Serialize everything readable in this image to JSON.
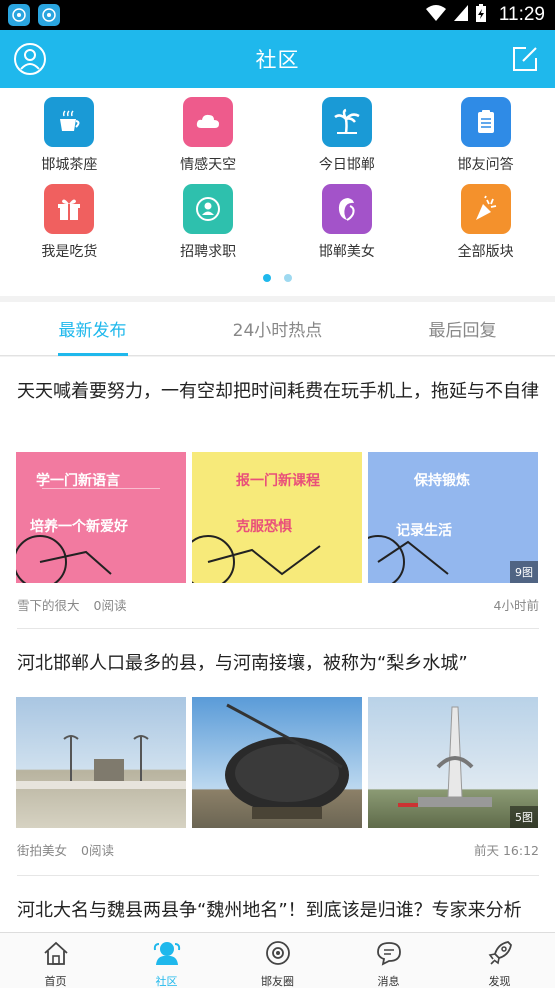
{
  "status_bar": {
    "time": "11:29",
    "left_icons": [
      "app-notification-icon",
      "app-notification-icon"
    ],
    "right_icons": [
      "wifi-icon",
      "signal-icon",
      "battery-charging-icon"
    ]
  },
  "header": {
    "title": "社区",
    "left_icon": "user-icon",
    "right_icon": "compose-icon"
  },
  "categories": [
    {
      "label": "邯城茶座",
      "icon": "tea-cup-icon",
      "color": "#1a9ad6"
    },
    {
      "label": "情感天空",
      "icon": "cloud-icon",
      "color": "#ee5b8c"
    },
    {
      "label": "今日邯郸",
      "icon": "palm-tree-icon",
      "color": "#1a9ad6"
    },
    {
      "label": "邯友问答",
      "icon": "clipboard-icon",
      "color": "#2f8be6"
    },
    {
      "label": "我是吃货",
      "icon": "gift-box-icon",
      "color": "#f0605f"
    },
    {
      "label": "招聘求职",
      "icon": "person-badge-icon",
      "color": "#2ec0ad"
    },
    {
      "label": "邯郸美女",
      "icon": "woman-profile-icon",
      "color": "#a353c9"
    },
    {
      "label": "全部版块",
      "icon": "party-popper-icon",
      "color": "#f4912c"
    }
  ],
  "pager": {
    "active_index": 0,
    "count": 2,
    "active_color": "#1fb8ec",
    "inactive_color": "#9ed9f0"
  },
  "tabs": [
    {
      "label": "最新发布",
      "active": true
    },
    {
      "label": "24小时热点",
      "active": false
    },
    {
      "label": "最后回复",
      "active": false
    }
  ],
  "posts": [
    {
      "title": "天天喊着要努力，一有空却把时间耗费在玩手机上，拖延与不自律",
      "author": "雪下的很大",
      "reads": "0阅读",
      "time": "4小时前",
      "image_count": "9图",
      "images": [
        {
          "heading1": "学一门新语言",
          "heading2": "培养一个新爱好",
          "bg": "#f27aa0"
        },
        {
          "heading1": "报一门新课程",
          "heading2": "克服恐惧",
          "bg": "#f7ea7a"
        },
        {
          "heading1": "保持锻炼",
          "heading2": "记录生活",
          "bg": "#93b7ee"
        }
      ]
    },
    {
      "title": "河北邯郸人口最多的县，与河南接壤，被称为“梨乡水城”",
      "author": "街拍美女",
      "reads": "0阅读",
      "time": "前天 16:12",
      "image_count": "5图"
    },
    {
      "title": "河北大名与魏县两县争“魏州地名”！到底该是归谁？专家来分析"
    }
  ],
  "bottom_nav": [
    {
      "label": "首页",
      "icon": "home-icon",
      "active": false
    },
    {
      "label": "社区",
      "icon": "community-icon",
      "active": true
    },
    {
      "label": "邯友圈",
      "icon": "camera-circle-icon",
      "active": false
    },
    {
      "label": "消息",
      "icon": "message-icon",
      "active": false
    },
    {
      "label": "发现",
      "icon": "rocket-icon",
      "active": false
    }
  ]
}
